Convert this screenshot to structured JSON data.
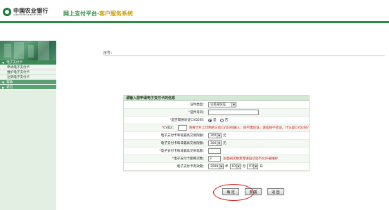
{
  "header": {
    "bank_name_cn": "中国农业银行",
    "bank_name_en": "AGRICULTURAL BANK OF CHINA",
    "portal_title": "网上支付平台",
    "portal_sep": "·",
    "portal_subtitle": "客户服务系统"
  },
  "sidebar": {
    "section_title": "电子支付卡",
    "items": [
      "申请电子支付卡",
      "维护电子支付卡",
      "注销电子支付卡"
    ],
    "help_label": "帮助",
    "logout_label": "退出"
  },
  "main": {
    "seq_label": "序号：",
    "form_title": "请输入您申请电子支付卡的信息",
    "rows": {
      "id_type": {
        "label": "证件类型：",
        "value": "公民身份证"
      },
      "id_number": {
        "label": "证件号码：",
        "value": ""
      },
      "cvd2_check": {
        "label": "是否需要验证CVD2码：",
        "yes": "是",
        "no": "否"
      },
      "cvd2": {
        "label": "CVD2：",
        "note": "请根卡片上印制的三位CVD2码输入；如不需验证，请选择不验证，什么是CVD2码?"
      },
      "single_limit": {
        "label": "电子支付卡单笔最高交易限额：",
        "value": "300",
        "unit": "元"
      },
      "daily_limit": {
        "label": "电子支付卡每日最高交易限额：",
        "value": "300",
        "unit": "元"
      },
      "daily_count": {
        "label": "电子支付卡每日最高交易笔数：",
        "value": ""
      },
      "usage_count": {
        "label": "电子支付卡使用次数：",
        "value": "3",
        "note": "注意刷次数至零请迫切您不允许被维护"
      },
      "expiry": {
        "label": "电子支付卡有效期：",
        "year": "2008",
        "year_unit": "年",
        "month": "03",
        "month_unit": "月",
        "day": "01",
        "day_unit": "日"
      }
    },
    "buttons": {
      "confirm": "确 定",
      "reset": "重 置",
      "back": "返 回"
    }
  },
  "colors": {
    "brand_green": "#2a8a4a",
    "sidebar_bg": "#e3efe3",
    "warning_red": "#d01010",
    "highlight_red": "#d41a1a",
    "subtitle_gold": "#c9a000"
  }
}
